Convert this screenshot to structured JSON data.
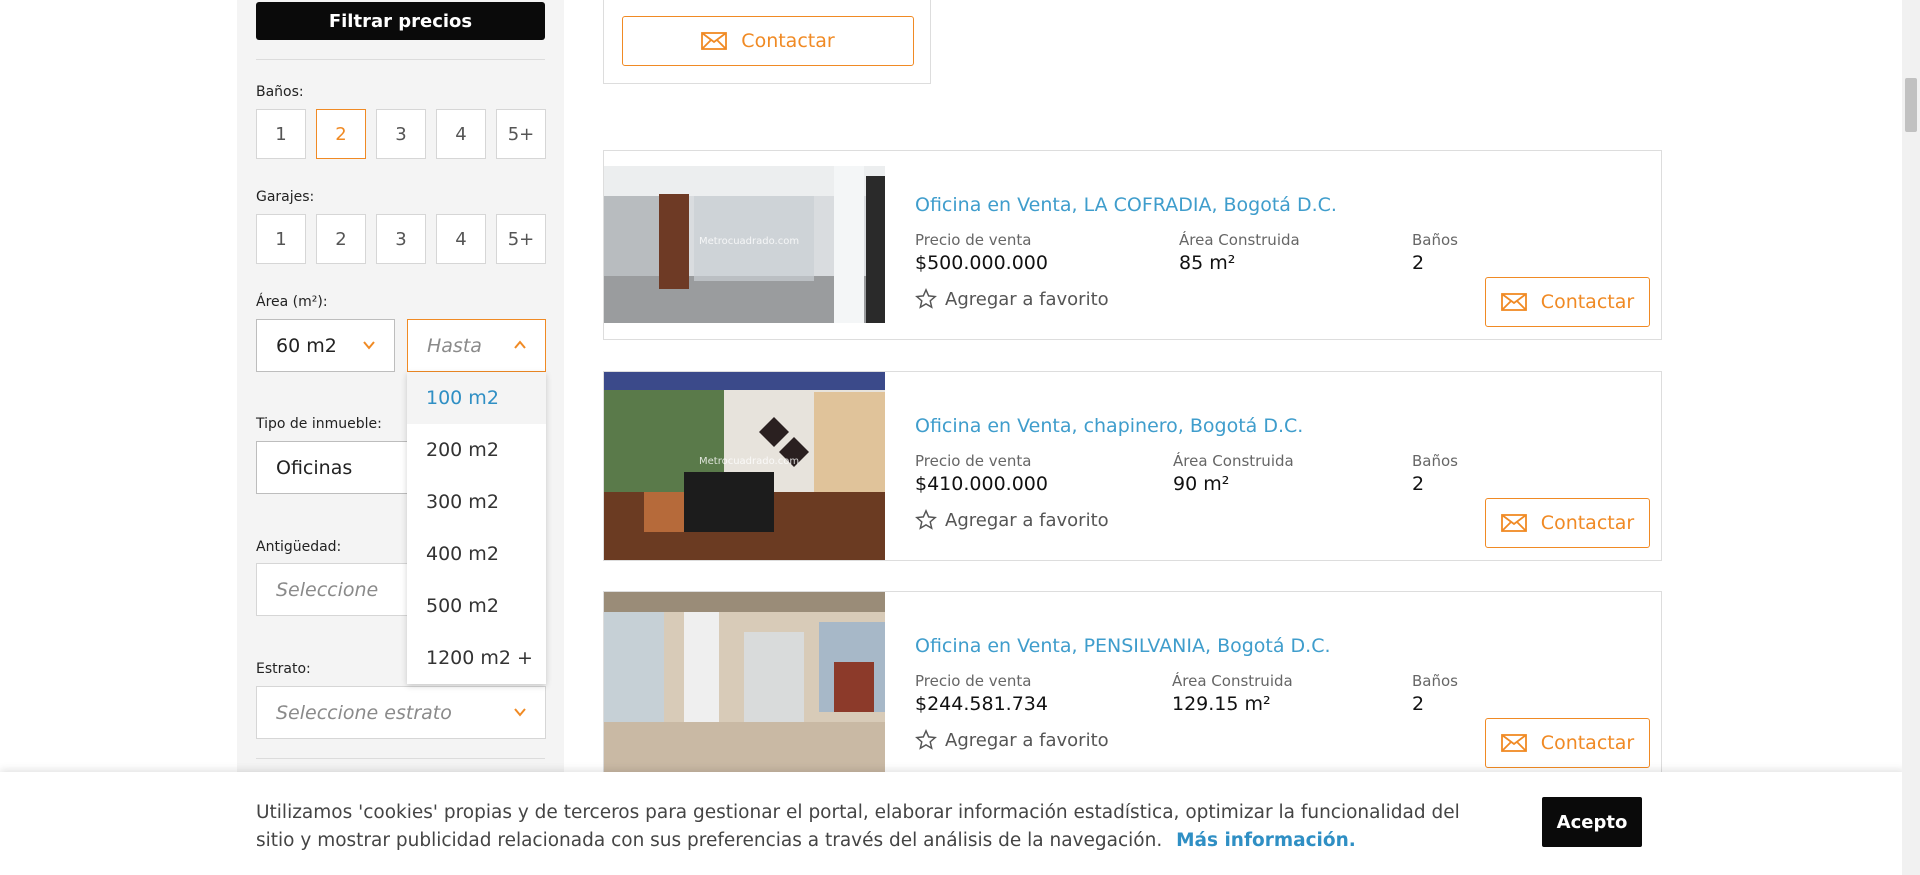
{
  "sidebar": {
    "filter_button": "Filtrar precios",
    "banos": {
      "label": "Baños:",
      "options": [
        "1",
        "2",
        "3",
        "4",
        "5+"
      ],
      "selected": "2"
    },
    "garajes": {
      "label": "Garajes:",
      "options": [
        "1",
        "2",
        "3",
        "4",
        "5+"
      ]
    },
    "area": {
      "label": "Área (m²):",
      "from_value": "60 m2",
      "to_placeholder": "Hasta",
      "dropdown_options": [
        "100 m2",
        "200 m2",
        "300 m2",
        "400 m2",
        "500 m2",
        "1200 m2 +"
      ],
      "highlighted_option": "100 m2"
    },
    "tipo": {
      "label": "Tipo de inmueble:",
      "value": "Oficinas"
    },
    "antiguedad": {
      "label": "Antigüedad:",
      "placeholder": "Seleccione"
    },
    "estrato": {
      "label": "Estrato:",
      "placeholder": "Seleccione estrato"
    }
  },
  "top_card": {
    "contact_label": "Contactar"
  },
  "listings": [
    {
      "title": "Oficina en Venta, LA COFRADIA, Bogotá D.C.",
      "price_label": "Precio de venta",
      "price": "$500.000.000",
      "area_label": "Área Construida",
      "area": "85 m²",
      "baths_label": "Baños",
      "baths": "2",
      "favorite_label": "Agregar a favorito",
      "contact_label": "Contactar",
      "watermark": "Metrocuadrado.com"
    },
    {
      "title": "Oficina en Venta, chapinero, Bogotá D.C.",
      "price_label": "Precio de venta",
      "price": "$410.000.000",
      "area_label": "Área Construida",
      "area": "90 m²",
      "baths_label": "Baños",
      "baths": "2",
      "favorite_label": "Agregar a favorito",
      "contact_label": "Contactar",
      "watermark": "Metrocuadrado.com"
    },
    {
      "title": "Oficina en Venta, PENSILVANIA, Bogotá D.C.",
      "price_label": "Precio de venta",
      "price": "$244.581.734",
      "area_label": "Área Construida",
      "area": "129.15 m²",
      "baths_label": "Baños",
      "baths": "2",
      "favorite_label": "Agregar a favorito",
      "contact_label": "Contactar"
    }
  ],
  "cookie": {
    "text": "Utilizamos 'cookies' propias y de terceros para gestionar el portal, elaborar información estadística, optimizar la funcionalidad del sitio y mostrar publicidad relacionada con sus preferencias a través del análisis de la navegación.",
    "link": "Más información.",
    "accept": "Acepto"
  },
  "colors": {
    "accent": "#f08a24",
    "link": "#3f9dcc",
    "dark": "#0a0a0a"
  },
  "icons": [
    "mail-icon",
    "star-icon",
    "chevron-down-icon",
    "chevron-up-icon"
  ]
}
